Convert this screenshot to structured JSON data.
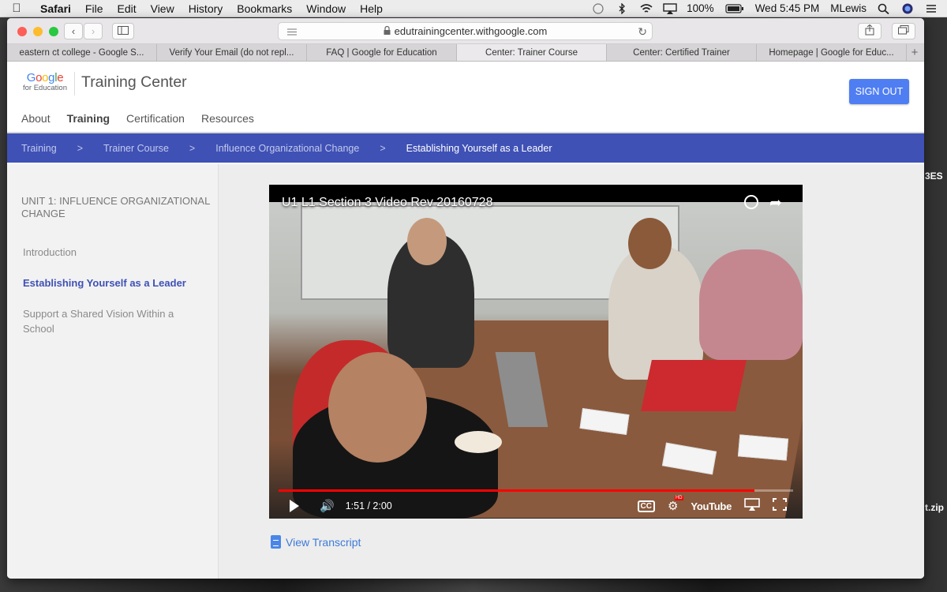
{
  "menubar": {
    "app_name": "Safari",
    "menus": [
      "File",
      "Edit",
      "View",
      "History",
      "Bookmarks",
      "Window",
      "Help"
    ],
    "battery": "100%",
    "clock": "Wed 5:45 PM",
    "user": "MLewis"
  },
  "browser": {
    "url": "edutrainingcenter.withgoogle.com",
    "tabs": [
      {
        "label": "eastern ct college - Google S..."
      },
      {
        "label": "Verify Your Email (do not repl..."
      },
      {
        "label": "FAQ | Google for Education"
      },
      {
        "label": "Center: Trainer Course"
      },
      {
        "label": "Center: Certified Trainer"
      },
      {
        "label": "Homepage | Google for Educ..."
      }
    ],
    "new_tab": "+"
  },
  "header": {
    "logo_google": "Google",
    "logo_sub": "for Education",
    "site_title": "Training Center",
    "sign_out": "SIGN OUT",
    "nav": [
      "About",
      "Training",
      "Certification",
      "Resources"
    ]
  },
  "breadcrumb": {
    "items": [
      "Training",
      "Trainer Course",
      "Influence Organizational Change",
      "Establishing Yourself as a Leader"
    ],
    "separator": ">"
  },
  "sidebar": {
    "unit_title": "UNIT 1: INFLUENCE ORGANIZATIONAL CHANGE",
    "items": [
      {
        "label": "Introduction"
      },
      {
        "label": "Establishing Yourself as a Leader"
      },
      {
        "label": "Support a Shared Vision Within a School"
      }
    ]
  },
  "video": {
    "title": "U1 L1 Section 3 Video Rev 20160728",
    "time": "1:51 / 2:00",
    "progress": 0.925,
    "cc_label": "CC",
    "youtube_label": "YouTube",
    "hd_label": "HD"
  },
  "transcript": {
    "label": "View Transcript"
  },
  "desktop": {
    "edge_texts": [
      "3ES",
      "t.zip"
    ]
  },
  "colors": {
    "breadcrumb_bg": "#3f51b5",
    "sign_out_bg": "#4f7ef3",
    "link": "#3d7ad8",
    "active_sidebar": "#3f51b5"
  }
}
